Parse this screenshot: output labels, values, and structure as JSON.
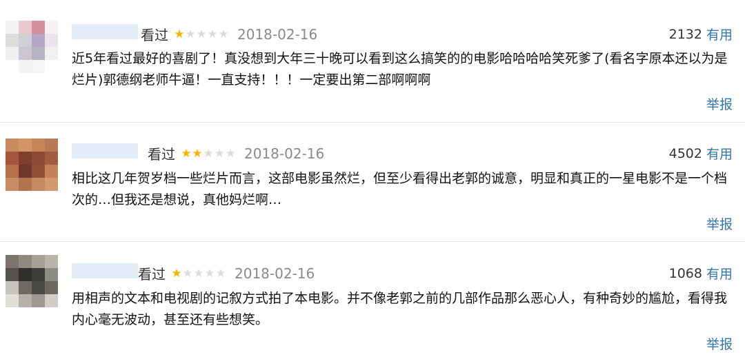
{
  "reviews": [
    {
      "status": "看过",
      "rating": 1,
      "date": "2018-02-16",
      "useful_count": "2132",
      "useful_label": "有用",
      "content": "近5年看过最好的喜剧了！真没想到大年三十晚可以看到这么搞笑的的电影哈哈哈哈笑死爹了(看名字原本还以为是烂片)郭德纲老师牛逼！一直支持！！！一定要出第二部啊啊啊",
      "report_label": "举报",
      "avatar_colors": [
        "#f3f3f3",
        "#e7c9cf",
        "#d78f9d",
        "#f7f2f4",
        "#dcdcdc",
        "#cfcfd6",
        "#b7a6c3",
        "#e9e4ee",
        "#f0f0f0",
        "#ccc6d3",
        "#b8b3c4",
        "#f1f1f1",
        "#ffffff",
        "#f4f4f4",
        "#f6f6f6",
        "#ffffff"
      ]
    },
    {
      "status": "看过",
      "rating": 2,
      "date": "2018-02-16",
      "useful_count": "4502",
      "useful_label": "有用",
      "content": "相比这几年贺岁档一些烂片而言，这部电影虽然烂，但至少看得出老郭的诚意，明显和真正的一星电影不是一个档次的…但我还是想说，真他妈烂啊…",
      "report_label": "举报",
      "avatar_colors": [
        "#c98a60",
        "#d49466",
        "#c88558",
        "#b67a57",
        "#a4573d",
        "#7f3f2c",
        "#8d4a35",
        "#a15b3e",
        "#b9714b",
        "#6f3a2c",
        "#914f36",
        "#c4825a",
        "#c98b63",
        "#b2734d",
        "#c78961",
        "#d49a6f"
      ]
    },
    {
      "status": "看过",
      "rating": 1,
      "date": "2018-02-16",
      "useful_count": "1068",
      "useful_label": "有用",
      "content": "用相声的文本和电视剧的记叙方式拍了本电影。并不像老郭之前的几部作品那么恶心人，有种奇妙的尴尬，看得我内心毫无波动，甚至还有些想笑。",
      "report_label": "举报",
      "avatar_colors": [
        "#7b766c",
        "#8d8a80",
        "#a5a197",
        "#b9b5aa",
        "#55524b",
        "#2f2f2c",
        "#3f3d38",
        "#8c8b84",
        "#c6c5bd",
        "#6d6a62",
        "#4a4945",
        "#6a685f",
        "#e0dfd8",
        "#b3b1a8",
        "#9b9990",
        "#cfcdc5"
      ]
    }
  ]
}
